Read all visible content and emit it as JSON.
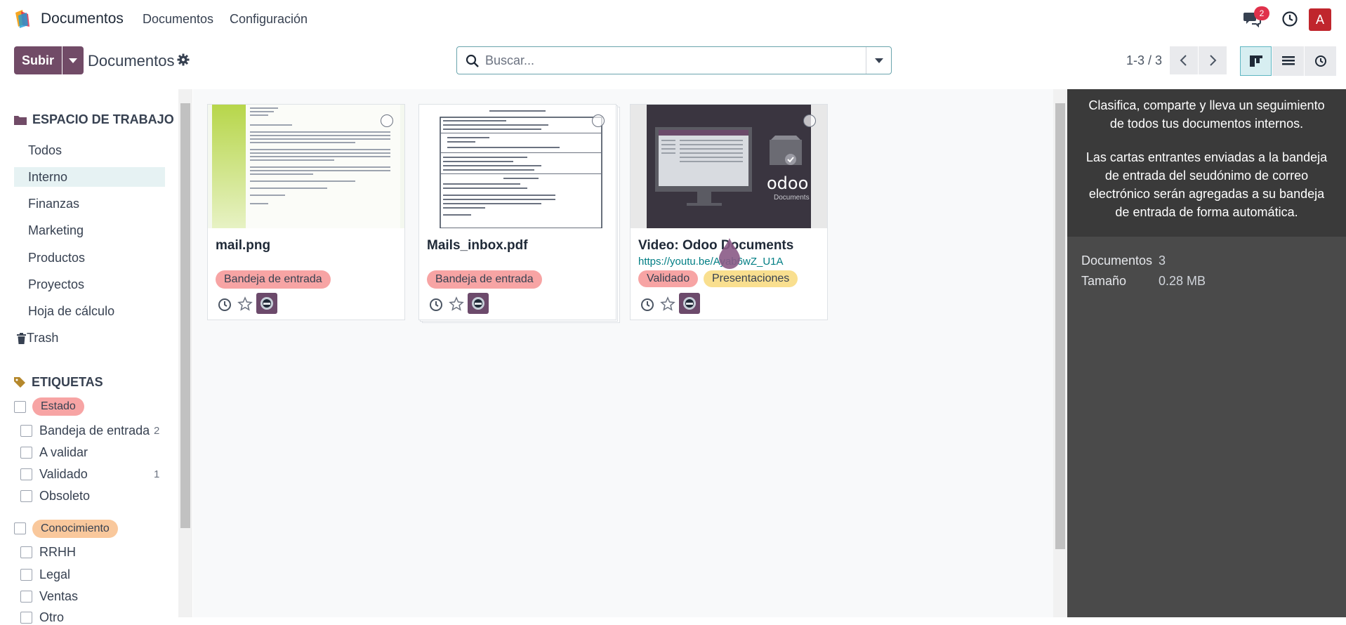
{
  "topnav": {
    "app_name": "Documentos",
    "menu": [
      "Documentos",
      "Configuración"
    ],
    "notification_count": "2",
    "avatar_letter": "A"
  },
  "control": {
    "upload_label": "Subir",
    "breadcrumb": "Documentos",
    "search_placeholder": "Buscar...",
    "pager": "1-3 / 3"
  },
  "sidebar": {
    "workspace_title": "ESPACIO DE TRABAJO",
    "workspaces": [
      "Todos",
      "Interno",
      "Finanzas",
      "Marketing",
      "Productos",
      "Proyectos",
      "Hoja de cálculo"
    ],
    "selected": "Interno",
    "trash_label": "Trash",
    "tags_title": "ETIQUETAS",
    "groups": [
      {
        "name": "Estado",
        "color": "#f7a4a4",
        "tags": [
          {
            "label": "Bandeja de entrada",
            "count": "2"
          },
          {
            "label": "A validar",
            "count": ""
          },
          {
            "label": "Validado",
            "count": "1"
          },
          {
            "label": "Obsoleto",
            "count": ""
          }
        ]
      },
      {
        "name": "Conocimiento",
        "color": "#f9c89c",
        "tags": [
          {
            "label": "RRHH",
            "count": ""
          },
          {
            "label": "Legal",
            "count": ""
          },
          {
            "label": "Ventas",
            "count": ""
          },
          {
            "label": "Otro",
            "count": ""
          }
        ]
      }
    ]
  },
  "cards": [
    {
      "name": "mail.png",
      "link": "",
      "tags": [
        "Bandeja de entrada"
      ]
    },
    {
      "name": "Mails_inbox.pdf",
      "link": "",
      "tags": [
        "Bandeja de entrada"
      ]
    },
    {
      "name": "Video: Odoo Documents",
      "link": "https://youtu.be/Ayab6wZ_U1A",
      "tags": [
        "Validado",
        "Presentaciones"
      ]
    }
  ],
  "preview_thumb": {
    "brand": "odoo",
    "subtitle": "Documents"
  },
  "rightpanel": {
    "intro1": "Clasifica, comparte y lleva un seguimiento de todos tus documentos internos.",
    "intro2": "Las cartas entrantes enviadas a la bandeja de entrada del seudónimo de correo electrónico serán agregadas a su bandeja de entrada de forma automática.",
    "doc_key": "Documentos",
    "doc_val": "3",
    "size_key": "Tamaño",
    "size_val": "0.28 MB"
  },
  "colors": {
    "brand": "#714b67",
    "accent": "#017e84"
  }
}
